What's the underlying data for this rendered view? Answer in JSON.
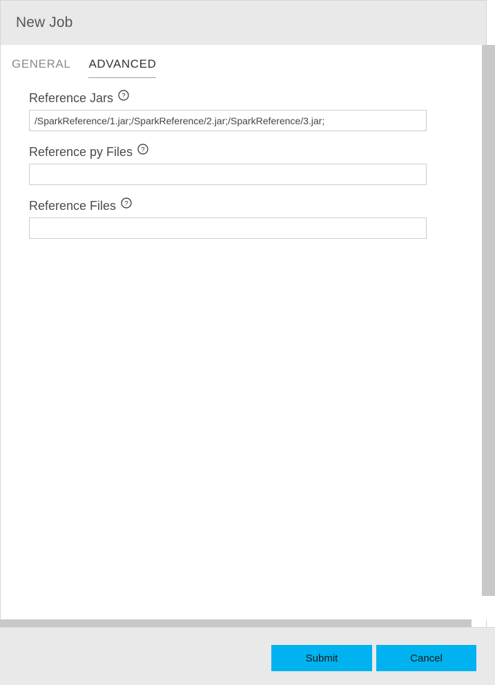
{
  "dialog": {
    "title": "New Job"
  },
  "tabs": [
    {
      "label": "GENERAL",
      "active": false
    },
    {
      "label": "ADVANCED",
      "active": true
    }
  ],
  "form": {
    "fields": [
      {
        "label": "Reference Jars",
        "help_icon": "help-circle-icon",
        "value": "/SparkReference/1.jar;/SparkReference/2.jar;/SparkReference/3.jar;",
        "placeholder": ""
      },
      {
        "label": "Reference py Files",
        "help_icon": "help-circle-icon",
        "value": "",
        "placeholder": ""
      },
      {
        "label": "Reference Files",
        "help_icon": "help-circle-icon",
        "value": "",
        "placeholder": ""
      }
    ]
  },
  "footer": {
    "submit_label": "Submit",
    "cancel_label": "Cancel"
  },
  "colors": {
    "accent": "#00b2ef",
    "titlebar_bg": "#e9e9e9",
    "footer_bg": "#e9e9e9",
    "scrollbar_thumb": "#c8c8c8",
    "tab_active_text": "#333333",
    "tab_inactive_text": "#8a8a8a"
  }
}
